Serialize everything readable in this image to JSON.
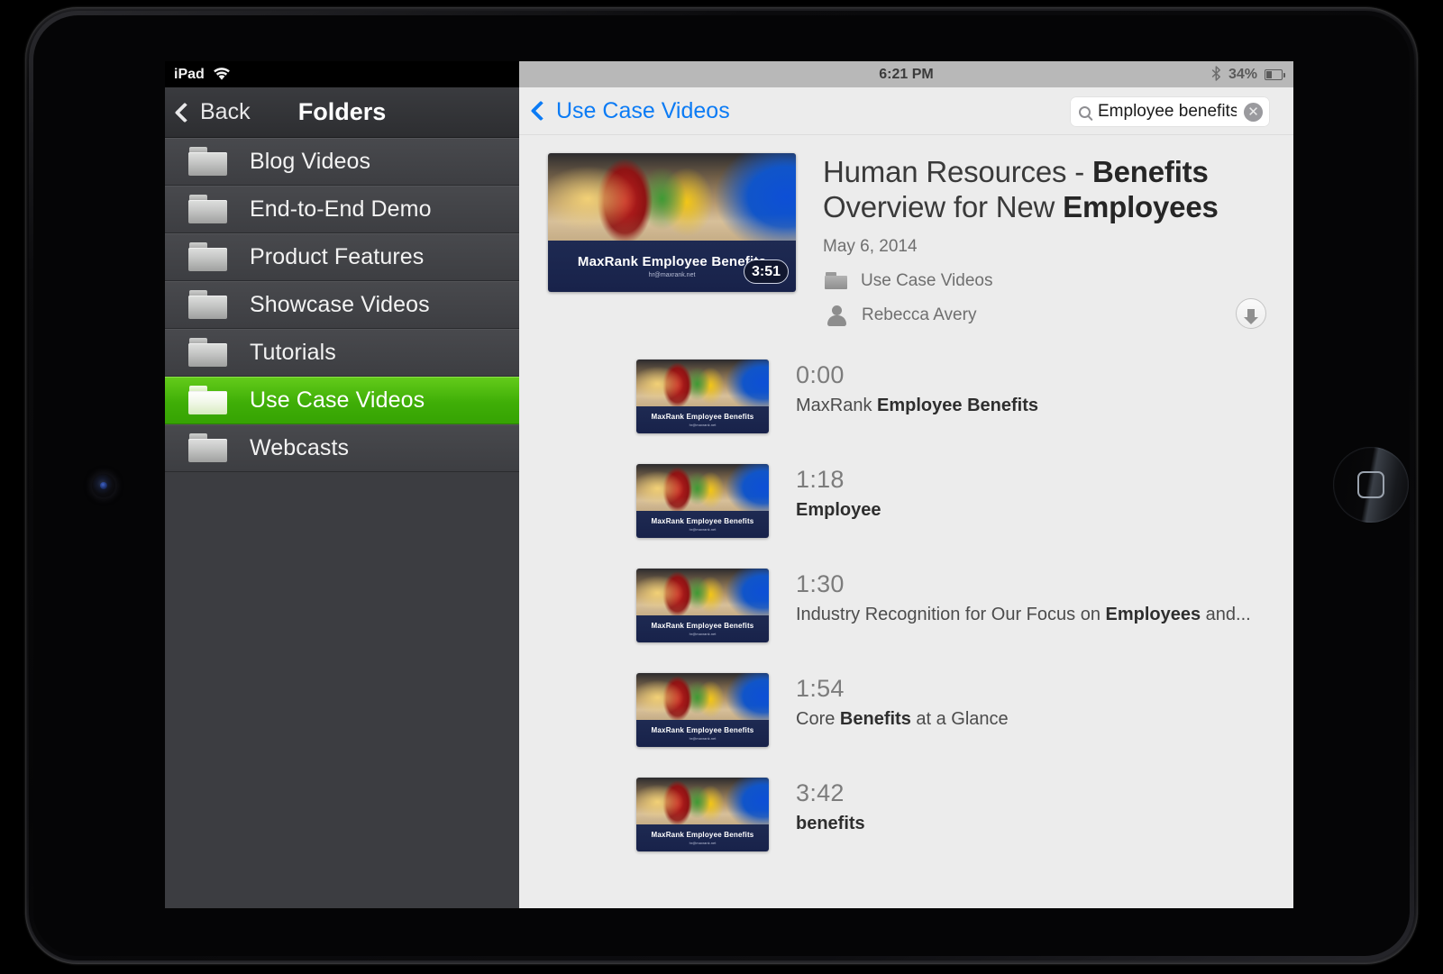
{
  "device": {
    "home_button": "home-button",
    "camera": "front-camera"
  },
  "master": {
    "status_bar": {
      "device_label": "iPad",
      "wifi_icon": "wifi-icon"
    },
    "nav": {
      "back_label": "Back",
      "title": "Folders",
      "back_icon": "chevron-left-icon"
    },
    "folders": [
      {
        "label": "Blog Videos",
        "selected": false
      },
      {
        "label": "End-to-End Demo",
        "selected": false
      },
      {
        "label": "Product Features",
        "selected": false
      },
      {
        "label": "Showcase Videos",
        "selected": false
      },
      {
        "label": "Tutorials",
        "selected": false
      },
      {
        "label": "Use Case Videos",
        "selected": true
      },
      {
        "label": "Webcasts",
        "selected": false
      }
    ],
    "selected_color": "#3fae07"
  },
  "detail": {
    "status_bar": {
      "time": "6:21 PM",
      "bluetooth_icon": "bluetooth-icon",
      "battery_percent": "34%",
      "battery_icon": "battery-icon",
      "battery_level": 34
    },
    "nav": {
      "back_label": "Use Case Videos",
      "back_icon": "chevron-left-icon",
      "accent_color": "#0b7bf5"
    },
    "search": {
      "value": "Employee benefits",
      "placeholder": "Search",
      "search_icon": "search-icon",
      "clear_icon": "clear-circle-icon",
      "clear_glyph": "✕"
    },
    "video": {
      "title_plain_1": "Human Resources - ",
      "title_bold_1": "Benefits",
      "title_plain_2": " Overview for New ",
      "title_bold_2": "Employees",
      "title_full": "Human Resources - Benefits Overview for New Employees",
      "date": "May 6, 2014",
      "folder_label": "Use Case Videos",
      "folder_icon": "folder-icon",
      "author": "Rebecca Avery",
      "author_icon": "person-icon",
      "duration": "3:51",
      "thumbnail_line1": "MaxRank Employee Benefits",
      "thumbnail_line2": "hr@maxrank.net",
      "download_icon": "download-arrow-icon"
    },
    "results": [
      {
        "time": "0:00",
        "caption_plain_1": "MaxRank ",
        "caption_bold": "Employee Benefits",
        "caption_plain_2": "",
        "caption_full": "MaxRank Employee Benefits"
      },
      {
        "time": "1:18",
        "caption_plain_1": "",
        "caption_bold": "Employee",
        "caption_plain_2": "",
        "caption_full": "Employee"
      },
      {
        "time": "1:30",
        "caption_plain_1": "Industry Recognition for Our Focus on ",
        "caption_bold": "Employees",
        "caption_plain_2": " and...",
        "caption_full": "Industry Recognition for Our Focus on Employees and..."
      },
      {
        "time": "1:54",
        "caption_plain_1": "Core ",
        "caption_bold": "Benefits",
        "caption_plain_2": " at a Glance",
        "caption_full": "Core Benefits at a Glance"
      },
      {
        "time": "3:42",
        "caption_plain_1": "",
        "caption_bold": "benefits",
        "caption_plain_2": "",
        "caption_full": "benefits"
      }
    ],
    "result_thumbnail": {
      "line1": "MaxRank Employee Benefits",
      "line2": "hr@maxrank.net"
    }
  }
}
